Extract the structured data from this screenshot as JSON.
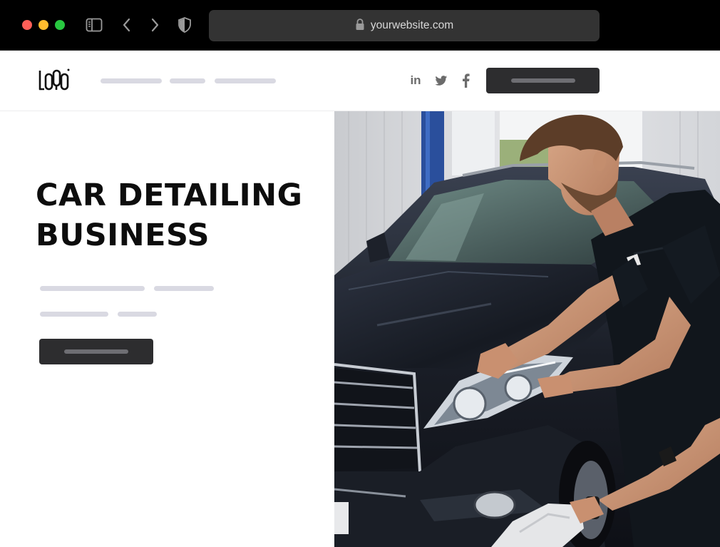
{
  "browser": {
    "url": "yourwebsite.com",
    "icons": [
      "sidebar-icon",
      "back-icon",
      "forward-icon",
      "shield-icon",
      "lock-icon"
    ]
  },
  "header": {
    "logo_text": "LOGO",
    "social_icons": [
      "linkedin-icon",
      "twitter-icon",
      "facebook-icon"
    ]
  },
  "hero": {
    "title_line_1": "CAR DETAILING",
    "title_line_2": "BUSINESS"
  },
  "colors": {
    "chrome_bg": "#000000",
    "url_bar": "#333333",
    "button_dark": "#2d2d2f",
    "placeholder_line": "#d9d9e2",
    "traffic_red": "#fe5f57",
    "traffic_yellow": "#febc2e",
    "traffic_green": "#28c840"
  }
}
